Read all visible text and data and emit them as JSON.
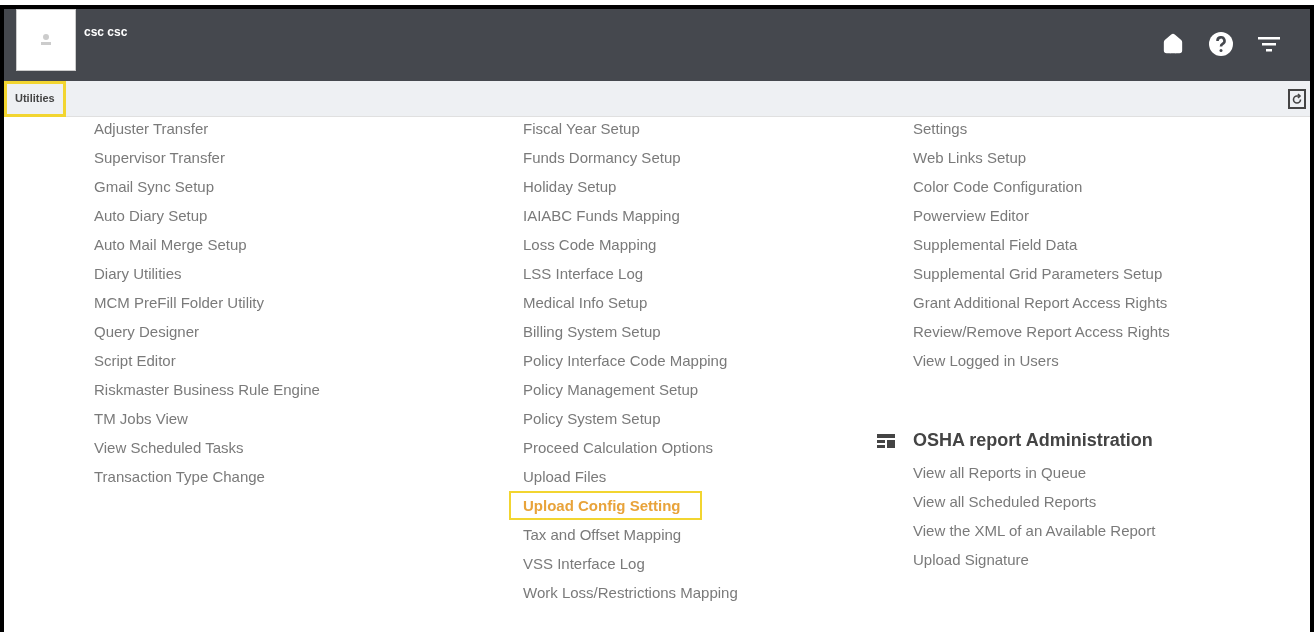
{
  "header": {
    "user_name": "csc csc"
  },
  "breadcrumb": {
    "label": "Utilities",
    "highlighted": true
  },
  "columns": [
    {
      "sections": [
        {
          "items": [
            {
              "label": "Adjuster Transfer",
              "highlighted": false
            },
            {
              "label": "Supervisor Transfer",
              "highlighted": false
            },
            {
              "label": "Gmail Sync Setup",
              "highlighted": false
            },
            {
              "label": "Auto Diary Setup",
              "highlighted": false
            },
            {
              "label": "Auto Mail Merge Setup",
              "highlighted": false
            },
            {
              "label": "Diary Utilities",
              "highlighted": false
            },
            {
              "label": "MCM PreFill Folder Utility",
              "highlighted": false
            },
            {
              "label": "Query Designer",
              "highlighted": false
            },
            {
              "label": "Script Editor",
              "highlighted": false
            },
            {
              "label": "Riskmaster Business Rule Engine",
              "highlighted": false
            },
            {
              "label": "TM Jobs View",
              "highlighted": false
            },
            {
              "label": "View Scheduled Tasks",
              "highlighted": false
            },
            {
              "label": "Transaction Type Change",
              "highlighted": false
            }
          ]
        }
      ]
    },
    {
      "sections": [
        {
          "items": [
            {
              "label": "Fiscal Year Setup",
              "highlighted": false
            },
            {
              "label": "Funds Dormancy Setup",
              "highlighted": false
            },
            {
              "label": "Holiday Setup",
              "highlighted": false
            },
            {
              "label": "IAIABC Funds Mapping",
              "highlighted": false
            },
            {
              "label": "Loss Code Mapping",
              "highlighted": false
            },
            {
              "label": "LSS Interface Log",
              "highlighted": false
            },
            {
              "label": "Medical Info Setup",
              "highlighted": false
            },
            {
              "label": "Billing System Setup",
              "highlighted": false
            },
            {
              "label": "Policy Interface Code Mapping",
              "highlighted": false
            },
            {
              "label": "Policy Management Setup",
              "highlighted": false
            },
            {
              "label": "Policy System Setup",
              "highlighted": false
            },
            {
              "label": "Proceed Calculation Options",
              "highlighted": false
            },
            {
              "label": "Upload Files",
              "highlighted": false
            },
            {
              "label": "Upload Config Setting",
              "highlighted": true
            },
            {
              "label": "Tax and Offset Mapping",
              "highlighted": false
            },
            {
              "label": "VSS Interface Log",
              "highlighted": false
            },
            {
              "label": "Work Loss/Restrictions Mapping",
              "highlighted": false
            }
          ]
        }
      ]
    },
    {
      "sections": [
        {
          "items": [
            {
              "label": "Settings",
              "highlighted": false
            },
            {
              "label": "Web Links Setup",
              "highlighted": false
            },
            {
              "label": "Color Code Configuration",
              "highlighted": false
            },
            {
              "label": "Powerview Editor",
              "highlighted": false
            },
            {
              "label": "Supplemental Field Data",
              "highlighted": false
            },
            {
              "label": "Supplemental Grid Parameters Setup",
              "highlighted": false
            },
            {
              "label": "Grant Additional Report Access Rights",
              "highlighted": false
            },
            {
              "label": "Review/Remove Report Access Rights",
              "highlighted": false
            },
            {
              "label": "View Logged in Users",
              "highlighted": false
            }
          ]
        },
        {
          "title": "OSHA report Administration",
          "items": [
            {
              "label": "View all Reports in Queue",
              "highlighted": false
            },
            {
              "label": "View all Scheduled Reports",
              "highlighted": false
            },
            {
              "label": "View the XML of an Available Report",
              "highlighted": false
            },
            {
              "label": "Upload Signature",
              "highlighted": false
            }
          ]
        }
      ]
    }
  ]
}
